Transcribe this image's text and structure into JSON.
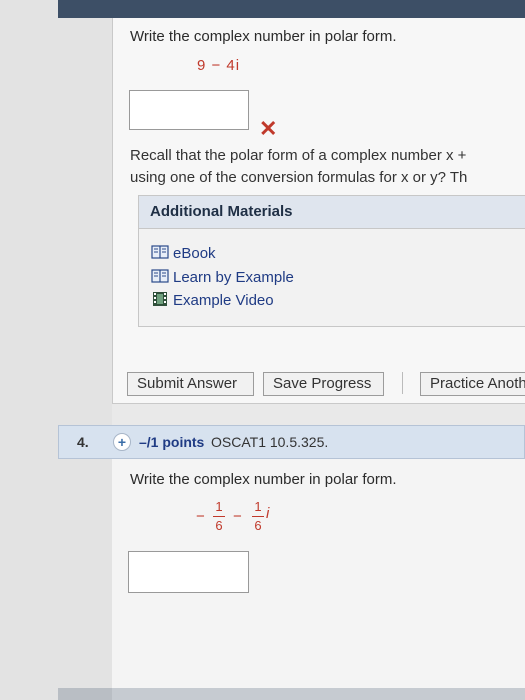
{
  "q3": {
    "prompt": "Write the complex number in polar form.",
    "expression": "9 − 4i",
    "answer_value": "",
    "hint_line1": "Recall that the polar form of a complex number x +",
    "hint_line2": "using one of the conversion formulas for x or y? Th",
    "additional_materials": {
      "title": "Additional Materials",
      "items": [
        {
          "label": "eBook",
          "icon": "book-icon"
        },
        {
          "label": "Learn by Example",
          "icon": "book-icon"
        },
        {
          "label": "Example Video",
          "icon": "film-icon"
        }
      ]
    },
    "buttons": {
      "submit": "Submit Answer",
      "save": "Save Progress",
      "practice": "Practice Anoth"
    }
  },
  "q4": {
    "number": "4.",
    "expand_icon": "+",
    "points": "–/1 points",
    "code": "OSCAT1 10.5.325.",
    "prompt": "Write the complex number in polar form.",
    "expr": {
      "a_num": "1",
      "a_den": "6",
      "minus1": "−",
      "minus2": "−",
      "b_num": "1",
      "b_den": "6",
      "i": "i"
    },
    "answer_value": ""
  },
  "colors": {
    "accent_red": "#c0392b",
    "link_blue": "#1f3b84",
    "header_bar": "#d7e2ef"
  }
}
